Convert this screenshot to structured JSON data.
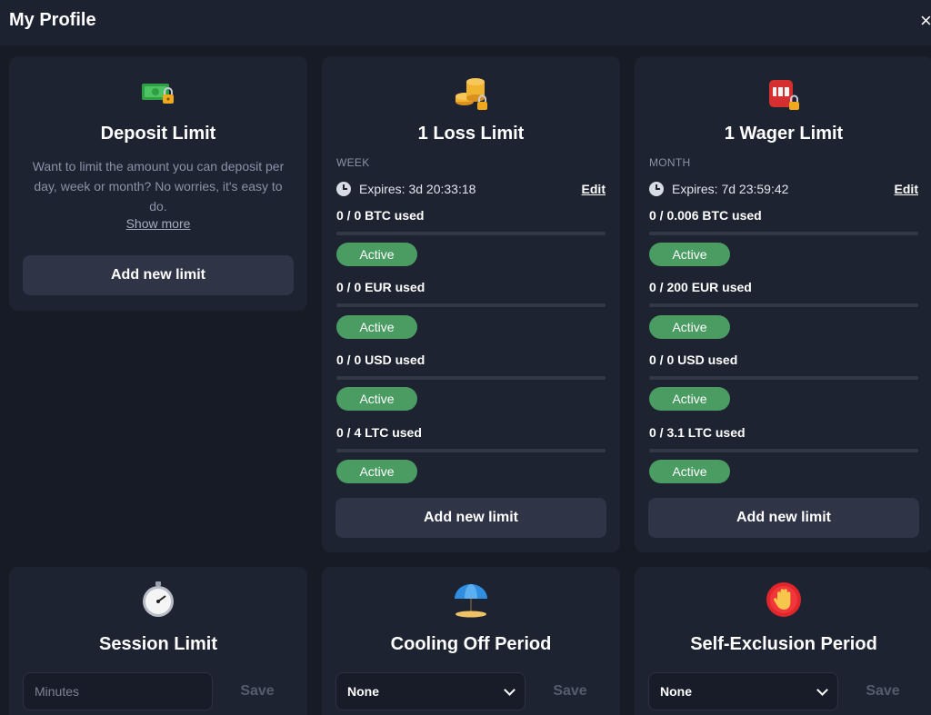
{
  "header": {
    "title": "My Profile",
    "close_label": "×"
  },
  "cards": {
    "deposit": {
      "icon": "cash-lock-icon",
      "title": "Deposit Limit",
      "description": "Want to limit the amount you can deposit per day, week or month? No worries, it's easy to do.",
      "show_more": "Show more",
      "button": "Add new limit"
    },
    "loss": {
      "icon": "coins-lock-icon",
      "title": "1 Loss Limit",
      "period": "WEEK",
      "expires": "Expires: 3d 20:33:18",
      "edit": "Edit",
      "items": [
        {
          "used": "0 / 0 BTC used",
          "status": "Active"
        },
        {
          "used": "0 / 0 EUR used",
          "status": "Active"
        },
        {
          "used": "0 / 0 USD used",
          "status": "Active"
        },
        {
          "used": "0 / 4 LTC used",
          "status": "Active"
        }
      ],
      "button": "Add new limit"
    },
    "wager": {
      "icon": "slot-machine-lock-icon",
      "title": "1 Wager Limit",
      "period": "MONTH",
      "expires": "Expires: 7d 23:59:42",
      "edit": "Edit",
      "items": [
        {
          "used": "0 / 0.006 BTC used",
          "status": "Active"
        },
        {
          "used": "0 / 200 EUR used",
          "status": "Active"
        },
        {
          "used": "0 / 0 USD used",
          "status": "Active"
        },
        {
          "used": "0 / 3.1 LTC used",
          "status": "Active"
        }
      ],
      "button": "Add new limit"
    },
    "session": {
      "icon": "stopwatch-icon",
      "title": "Session Limit",
      "placeholder": "Minutes",
      "save": "Save"
    },
    "cooling": {
      "icon": "beach-umbrella-icon",
      "title": "Cooling Off Period",
      "selected": "None",
      "save": "Save"
    },
    "exclusion": {
      "icon": "raised-hand-icon",
      "title": "Self-Exclusion Period",
      "selected": "None",
      "save": "Save"
    }
  },
  "colors": {
    "background": "#161b26",
    "card": "#1e2331",
    "button": "#2f3446",
    "active_badge": "#4a9c62",
    "muted_text": "#8b92a6"
  }
}
